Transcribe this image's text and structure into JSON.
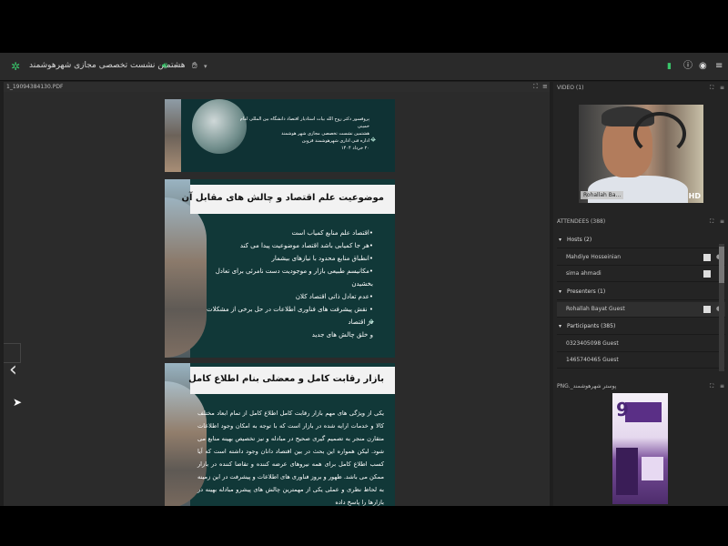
{
  "app": {
    "title": "هشتمین نشست تخصصی مجازی شهرهوشمند",
    "logo_icon": "participants-icon",
    "accent": "#39c46a"
  },
  "document_pod": {
    "file_name": "1_19094384130.PDF",
    "slides": [
      {
        "info_lines": [
          "پروفسور دکتر روح الله بیات استادیار اقتصاد دانشگاه بین المللی امام خمینی",
          "هشتمین نشست تخصصی مجازی شهر هوشمند",
          "اداره فنی اداری شهرهوشمند قزوین",
          "۲۰ خرداد ۱۴۰۴"
        ]
      },
      {
        "title": "موضوعیت علم اقتصاد و چالش های مقابل آن",
        "bullets": [
          "•اقتصاد علم منابع کمیاب است",
          "•هر جا کمیابی باشد اقتصاد موضوعیت پیدا می کند",
          "•انطباق منابع محدود با نیازهای بیشمار",
          "•مکانیسم طبیعی بازار و موجودیت دست نامرئی برای تعادل بخشیدن",
          "•عدم تعادل ذاتی اقتصاد کلان",
          "• نقش پیشرفت های فناوری اطلاعات در حل برخی از مشکلات در اقتصاد",
          "و خلق چالش های جدید"
        ]
      },
      {
        "title": "بازار رقابت کامل و معضلی بنام اطلاع کامل",
        "paragraph": "یکی از ویژگی های مهم بازار رقابت کامل اطلاع کامل از تمام ابعاد مختلف کالا و خدمات ارایه شده در بازار است که با توجه به امکان وجود اطلاعات متقارن منجر به تصمیم گیری صحیح در مبادله و نیز تخصیص بهینه منابع می شود. لیکن همواره این بحث در بین اقتصاد دانان وجود داشته است که آیا کسب اطلاع کامل برای همه نیروهای عرضه کننده و تقاضا کننده در بازار ممکن می باشد. ظهور و بروز فناوری های اطلاعات و پیشرفت در این زمینه به لحاظ نظری و عملی یکی از مهمترین چالش های پیشرو مبادله بهینه در بازارها را پاسخ داده"
      }
    ]
  },
  "video_pod": {
    "header": "VIDEO (1)",
    "participant_label": "Rohallah Ba...",
    "hd_label": "HD"
  },
  "attendees_pod": {
    "header": "ATTENDEES (388)",
    "groups": [
      {
        "label": "Hosts (2)",
        "members": [
          "Mahdiye Hosseinian",
          "sima ahmadi"
        ]
      },
      {
        "label": "Presenters (1)",
        "members": [
          "Rohallah Bayat  Guest"
        ]
      },
      {
        "label": "Participants (385)",
        "members": [
          "0323405098  Guest",
          "1465740465  Guest"
        ]
      }
    ]
  },
  "image_pod": {
    "header": "پوستر شهرهوشمند_.PNG",
    "poster_number": "9"
  }
}
